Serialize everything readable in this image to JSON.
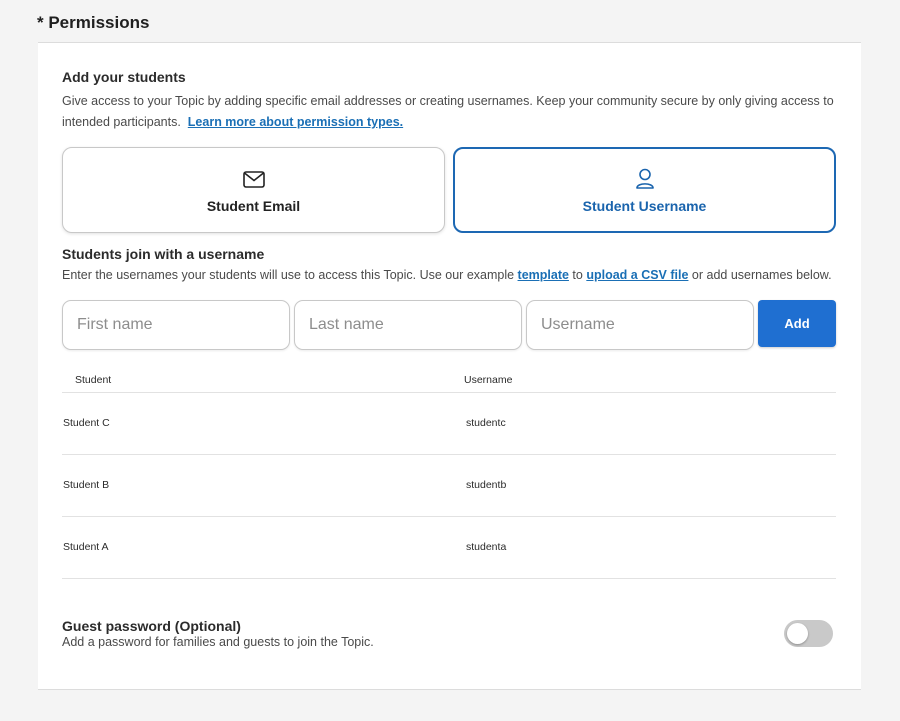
{
  "section": {
    "title": "* Permissions"
  },
  "intro": {
    "heading": "Add your students",
    "text_line1": "Give access to your Topic by adding specific email addresses or creating usernames. Keep your community secure by only giving access to",
    "text_line2": "intended participants.",
    "link": "Learn more about permission types."
  },
  "options": [
    {
      "label": "Student Email",
      "icon": "envelope-icon",
      "selected": false
    },
    {
      "label": "Student Username",
      "icon": "user-icon",
      "selected": true
    }
  ],
  "join": {
    "heading": "Students join with a username",
    "text_before": "Enter the usernames your students will use to access this Topic. Use our example ",
    "template_link": "template",
    "text_middle": " to ",
    "csv_link": "upload a CSV file",
    "text_after": " or add usernames below."
  },
  "form": {
    "first_name_placeholder": "First name",
    "last_name_placeholder": "Last name",
    "username_placeholder": "Username",
    "add_label": "Add"
  },
  "table": {
    "headers": [
      "Student",
      "Username"
    ],
    "rows": [
      {
        "student": "Student C",
        "username": "studentc"
      },
      {
        "student": "Student B",
        "username": "studentb"
      },
      {
        "student": "Student A",
        "username": "studenta"
      }
    ]
  },
  "guest": {
    "heading": "Guest password (Optional)",
    "text": "Add a password for families and guests to join the Topic.",
    "enabled": false
  },
  "colors": {
    "accent": "#1f6fd1",
    "link": "#1a6fb5",
    "selected_border": "#1d68b3"
  }
}
